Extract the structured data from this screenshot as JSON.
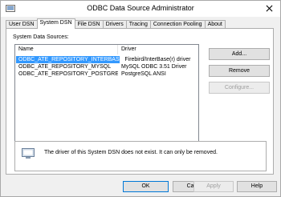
{
  "window": {
    "title": "ODBC Data Source Administrator"
  },
  "tabs": [
    {
      "label": "User DSN",
      "active": false
    },
    {
      "label": "System DSN",
      "active": true
    },
    {
      "label": "File DSN",
      "active": false
    },
    {
      "label": "Drivers",
      "active": false
    },
    {
      "label": "Tracing",
      "active": false
    },
    {
      "label": "Connection Pooling",
      "active": false
    },
    {
      "label": "About",
      "active": false
    }
  ],
  "panel": {
    "section_label": "System Data Sources:",
    "columns": {
      "name": "Name",
      "driver": "Driver"
    },
    "rows": [
      {
        "name": "ODBC_ATE_REPOSITORY_INTERBASE",
        "driver": "Firebird/InterBase(r) driver",
        "selected": true
      },
      {
        "name": "ODBC_ATE_REPOSITORY_MYSQL",
        "driver": "MySQL ODBC 3.51 Driver",
        "selected": false
      },
      {
        "name": "ODBC_ATE_REPOSITORY_POSTGRESQL",
        "driver": "PostgreSQL ANSI",
        "selected": false
      }
    ],
    "buttons": {
      "add": "Add...",
      "remove": "Remove",
      "configure": "Configure..."
    },
    "info_text": "The driver of this System DSN does not exist. It can only be removed."
  },
  "footer": {
    "ok": "OK",
    "cancel": "Cancel",
    "apply": "Apply",
    "help": "Help"
  },
  "colors": {
    "selection": "#3399ff",
    "window_bg": "#f0f0f0",
    "default_button_border": "#0078d7"
  },
  "icons": {
    "app": "odbc-app-icon",
    "close": "close-icon",
    "info": "info-dsn-icon"
  }
}
